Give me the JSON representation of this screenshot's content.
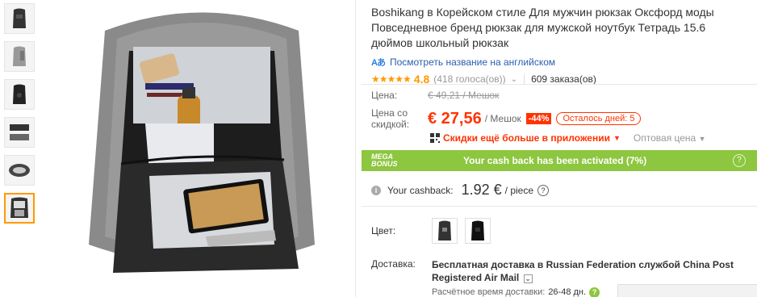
{
  "product": {
    "title": "Boshikang в Корейском стиле Для мужчин рюкзак Оксфорд моды Повседневное бренд рюкзак для мужской ноутбук Тетрадь 15.6 дюймов школьный рюкзак",
    "translate_link": "Посмотреть название на английском",
    "rating": "4.8",
    "votes": "(418 голоса(ов))",
    "orders": "609 заказа(ов)"
  },
  "price": {
    "label": "Цена:",
    "old": "€ 49,21 / Мешок",
    "discount_label": "Цена со скидкой:",
    "new": "€ 27,56",
    "unit": "/ Мешок",
    "discount": "-44%",
    "days_left": "Осталось дней: 5",
    "app_link": "Скидки ещё больше в приложении",
    "wholesale": "Оптовая цена"
  },
  "mega": {
    "badge_line1": "MEGA",
    "badge_line2": "BONUS",
    "text": "Your cash back has been activated (7%)",
    "help": "?"
  },
  "cashback": {
    "label": "Your cashback:",
    "value": "1.92 €",
    "unit": "/ piece",
    "help": "?"
  },
  "color": {
    "label": "Цвет:"
  },
  "shipping": {
    "label": "Доставка:",
    "free_prefix": "Бесплатная доставка в",
    "destination": "Russian Federation",
    "service_prefix": "службой",
    "service": "China Post Registered Air Mail",
    "eta_label": "Расчётное время доставки:",
    "eta_value": "26-48 дн."
  },
  "colors": {
    "accent": "#f30",
    "mega_green": "#8dc63f",
    "link_blue": "#2a5db0",
    "star_orange": "#f90"
  }
}
